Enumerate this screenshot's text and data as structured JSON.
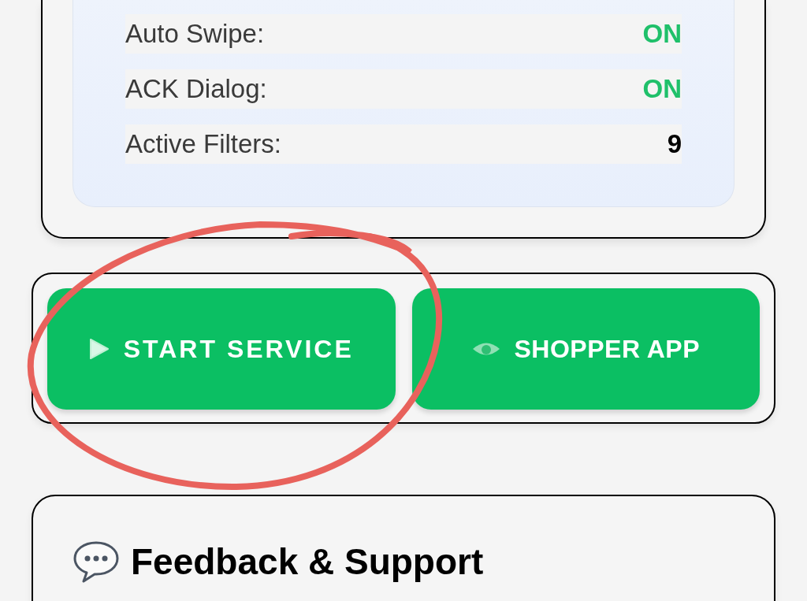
{
  "settings": [
    {
      "label": "Auto Swipe:",
      "value": "ON",
      "kind": "toggle"
    },
    {
      "label": "ACK Dialog:",
      "value": "ON",
      "kind": "toggle"
    },
    {
      "label": "Active Filters:",
      "value": "9",
      "kind": "number"
    }
  ],
  "actions": [
    {
      "label": "START SERVICE",
      "kind": "start"
    },
    {
      "label": "SHOPPER APP",
      "kind": "view"
    }
  ],
  "feedback": {
    "title": "Feedback & Support"
  },
  "annotation": {
    "kind": "circle"
  }
}
